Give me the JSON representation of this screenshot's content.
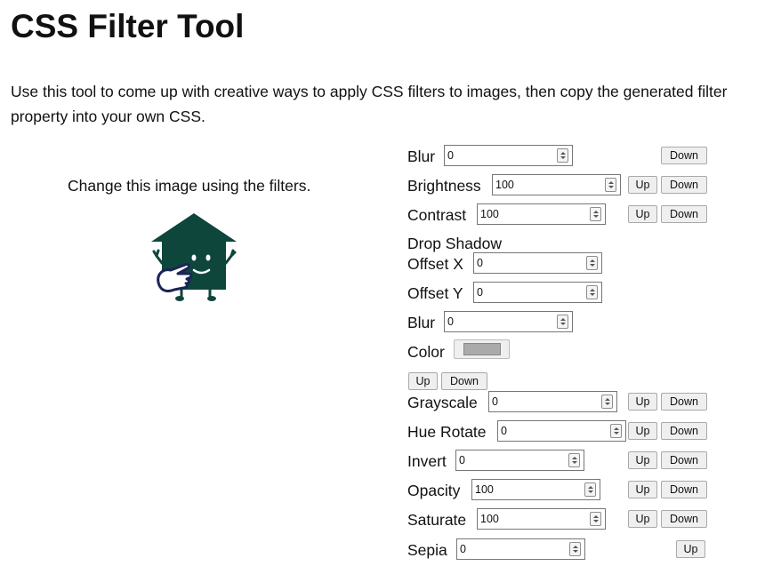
{
  "page": {
    "title": "CSS Filter Tool",
    "intro": "Use this tool to come up with creative ways to apply CSS filters to images, then copy the generated filter property into your own CSS.",
    "image_caption": "Change this image using the filters."
  },
  "buttons": {
    "up": "Up",
    "down": "Down"
  },
  "filters": {
    "blur": {
      "label": "Blur",
      "value": "0"
    },
    "brightness": {
      "label": "Brightness",
      "value": "100"
    },
    "contrast": {
      "label": "Contrast",
      "value": "100"
    },
    "drop_shadow": {
      "heading": "Drop Shadow",
      "offset_x": {
        "label": "Offset X",
        "value": "0"
      },
      "offset_y": {
        "label": "Offset Y",
        "value": "0"
      },
      "blur": {
        "label": "Blur",
        "value": "0"
      },
      "color": {
        "label": "Color",
        "value": "#aaaaaa"
      }
    },
    "grayscale": {
      "label": "Grayscale",
      "value": "0"
    },
    "hue_rotate": {
      "label": "Hue Rotate",
      "value": "0"
    },
    "invert": {
      "label": "Invert",
      "value": "0"
    },
    "opacity": {
      "label": "Opacity",
      "value": "100"
    },
    "saturate": {
      "label": "Saturate",
      "value": "100"
    },
    "sepia": {
      "label": "Sepia",
      "value": "0"
    }
  },
  "colors": {
    "house": "#0e463c",
    "hand_outline": "#1b2556",
    "drop_shadow_swatch": "#aaaaaa"
  }
}
